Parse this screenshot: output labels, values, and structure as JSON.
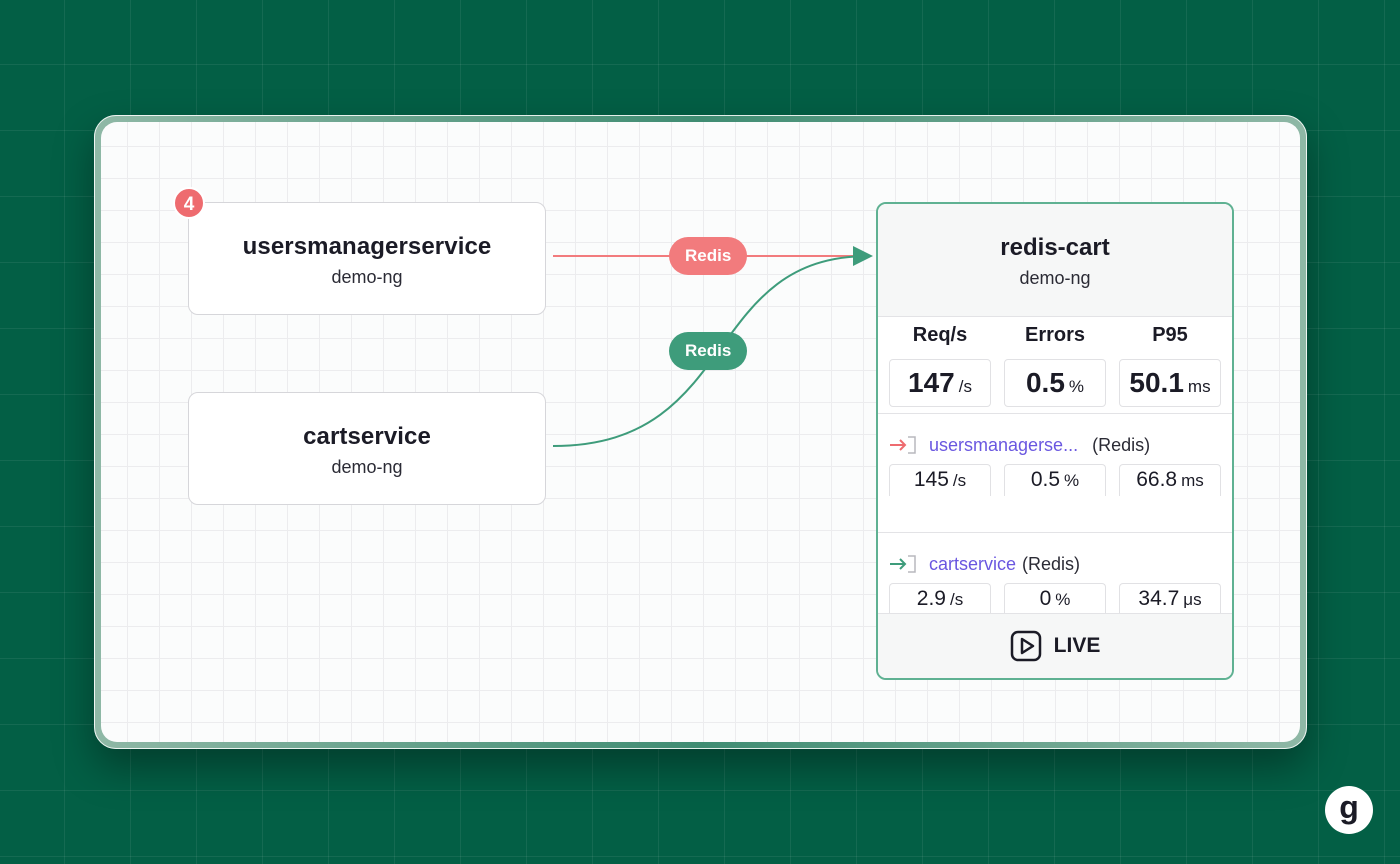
{
  "nodes": {
    "usersmanager": {
      "name": "usersmanagerservice",
      "namespace": "demo-ng",
      "badge": "4"
    },
    "cartservice": {
      "name": "cartservice",
      "namespace": "demo-ng"
    }
  },
  "edges": {
    "usersmanager_label": "Redis",
    "cartservice_label": "Redis",
    "colors": {
      "usersmanager": "#f27b7d",
      "cartservice": "#3e9c7b"
    }
  },
  "panel": {
    "title": "redis-cart",
    "namespace": "demo-ng",
    "stats": {
      "req_header": "Req/s",
      "req_value": "147",
      "req_unit": "/s",
      "err_header": "Errors",
      "err_value": "0.5",
      "err_unit": "%",
      "p95_header": "P95",
      "p95_value": "50.1",
      "p95_unit": "ms"
    },
    "sources": [
      {
        "name": "usersmanagerse...",
        "kind": "(Redis)",
        "req": "145",
        "req_unit": "/s",
        "err": "0.5",
        "err_unit": "%",
        "p95": "66.8",
        "p95_unit": "ms",
        "icon": "arrow-right-into-box-icon",
        "color": "#ee6b6f"
      },
      {
        "name": "cartservice",
        "kind": "(Redis)",
        "req": "2.9",
        "req_unit": "/s",
        "err": "0",
        "err_unit": "%",
        "p95": "34.7",
        "p95_unit": "μs",
        "icon": "arrow-right-into-box-icon",
        "color": "#3e9c7b"
      }
    ],
    "live_label": "LIVE"
  },
  "logo": "g",
  "colors": {
    "accent_green": "#5fb192",
    "link": "#6a57e0",
    "background": "#035f45"
  }
}
